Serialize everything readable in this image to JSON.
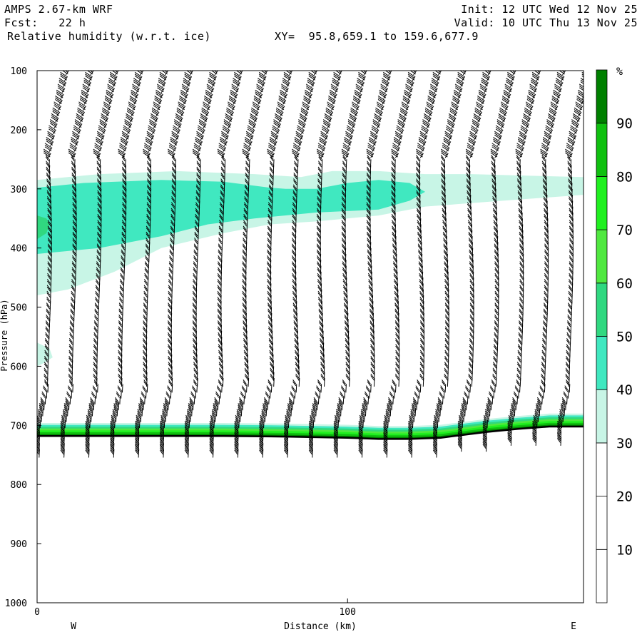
{
  "header": {
    "model": "AMPS 2.67-km WRF",
    "init": "Init: 12 UTC Wed 12 Nov 25",
    "fcst_label": "Fcst:",
    "fcst_value": "22 h",
    "valid": "Valid: 10 UTC Thu 13 Nov 25",
    "field": "Relative humidity (w.r.t. ice)",
    "xy": "XY=  95.8,659.1 to 159.6,677.9"
  },
  "chart_data": {
    "type": "heatmap",
    "title": "",
    "xlabel": "Distance (km)",
    "ylabel": "Pressure (hPa)",
    "xlim": [
      0,
      176
    ],
    "ylim": [
      1000,
      100
    ],
    "x_ticks": [
      "0",
      "100"
    ],
    "x_tick_values": [
      0,
      100
    ],
    "y_ticks": [
      "100",
      "200",
      "300",
      "400",
      "500",
      "600",
      "700",
      "800",
      "900",
      "1000"
    ],
    "y_tick_values": [
      100,
      200,
      300,
      400,
      500,
      600,
      700,
      800,
      900,
      1000
    ],
    "west_label": "W",
    "east_label": "E",
    "colorbar": {
      "unit": "%",
      "levels": [
        0,
        10,
        20,
        30,
        40,
        50,
        60,
        70,
        80,
        90,
        100
      ],
      "tick_labels": [
        "10",
        "20",
        "30",
        "40",
        "50",
        "60",
        "70",
        "80",
        "90"
      ],
      "colors": [
        "#ffffff",
        "#ffffff",
        "#ffffff",
        "#c8f5e6",
        "#40e8c0",
        "#30d880",
        "#50e840",
        "#20f020",
        "#10c010",
        "#008000"
      ]
    },
    "regions": [
      {
        "level": "30-40",
        "color": "#c8f5e6",
        "polygon": [
          [
            0,
            285
          ],
          [
            20,
            275
          ],
          [
            45,
            270
          ],
          [
            70,
            275
          ],
          [
            85,
            280
          ],
          [
            95,
            270
          ],
          [
            110,
            270
          ],
          [
            125,
            275
          ],
          [
            140,
            275
          ],
          [
            160,
            278
          ],
          [
            176,
            280
          ],
          [
            176,
            310
          ],
          [
            150,
            320
          ],
          [
            125,
            330
          ],
          [
            110,
            345
          ],
          [
            90,
            355
          ],
          [
            75,
            360
          ],
          [
            60,
            375
          ],
          [
            40,
            400
          ],
          [
            25,
            440
          ],
          [
            10,
            470
          ],
          [
            0,
            480
          ]
        ]
      },
      {
        "level": "30-40",
        "color": "#c8f5e6",
        "polygon": [
          [
            0,
            560
          ],
          [
            4,
            570
          ],
          [
            5,
            585
          ],
          [
            2,
            595
          ],
          [
            0,
            600
          ]
        ]
      },
      {
        "level": "40-50",
        "color": "#40e8c0",
        "polygon": [
          [
            0,
            298
          ],
          [
            15,
            290
          ],
          [
            40,
            285
          ],
          [
            60,
            288
          ],
          [
            75,
            298
          ],
          [
            80,
            300
          ],
          [
            90,
            300
          ],
          [
            100,
            290
          ],
          [
            110,
            285
          ],
          [
            120,
            290
          ],
          [
            125,
            305
          ],
          [
            120,
            320
          ],
          [
            110,
            335
          ],
          [
            90,
            340
          ],
          [
            70,
            350
          ],
          [
            55,
            360
          ],
          [
            40,
            380
          ],
          [
            20,
            400
          ],
          [
            0,
            410
          ]
        ]
      },
      {
        "level": "50-60",
        "color": "#30d880",
        "polygon": [
          [
            0,
            345
          ],
          [
            3,
            350
          ],
          [
            4,
            360
          ],
          [
            3,
            375
          ],
          [
            0,
            385
          ]
        ]
      }
    ],
    "surface": {
      "x": [
        0,
        20,
        40,
        60,
        80,
        100,
        110,
        120,
        130,
        145,
        155,
        165,
        176
      ],
      "p": [
        718,
        718,
        718,
        718,
        719,
        721,
        723,
        723,
        721,
        711,
        706,
        702,
        702
      ]
    },
    "surface_moist_layer": {
      "rh_max_percent": 90,
      "top_offset_hpa": 22
    },
    "wind_barbs": {
      "columns_x_km": [
        4,
        12,
        20,
        28,
        36,
        44,
        52,
        60,
        68,
        76,
        84,
        92,
        100,
        108,
        116,
        124,
        132,
        140,
        148,
        156,
        164,
        172
      ],
      "barb_spacing_hpa": 10,
      "top_hpa": 100,
      "shaft_color": "#000000"
    }
  }
}
